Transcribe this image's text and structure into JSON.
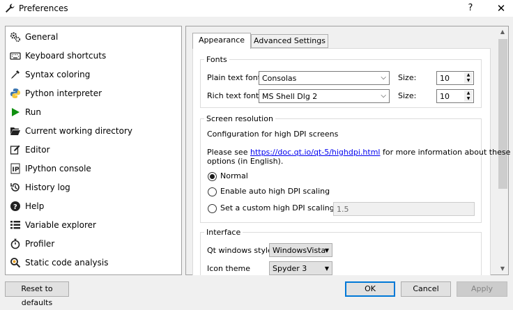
{
  "window": {
    "title": "Preferences",
    "help_glyph": "?",
    "close_glyph": "✕"
  },
  "sidebar": {
    "items": [
      {
        "label": "General",
        "icon": "gears-icon"
      },
      {
        "label": "Keyboard shortcuts",
        "icon": "keyboard-icon"
      },
      {
        "label": "Syntax coloring",
        "icon": "eyedropper-icon"
      },
      {
        "label": "Python interpreter",
        "icon": "python-icon"
      },
      {
        "label": "Run",
        "icon": "play-icon"
      },
      {
        "label": "Current working directory",
        "icon": "folder-open-icon"
      },
      {
        "label": "Editor",
        "icon": "edit-icon"
      },
      {
        "label": "IPython console",
        "icon": "ipython-icon"
      },
      {
        "label": "History log",
        "icon": "history-icon"
      },
      {
        "label": "Help",
        "icon": "question-circle-icon"
      },
      {
        "label": "Variable explorer",
        "icon": "table-list-icon"
      },
      {
        "label": "Profiler",
        "icon": "stopwatch-icon"
      },
      {
        "label": "Static code analysis",
        "icon": "code-analysis-icon"
      }
    ]
  },
  "tabs": [
    {
      "label": "Appearance",
      "selected": true
    },
    {
      "label": "Advanced Settings",
      "selected": false
    }
  ],
  "fonts": {
    "title": "Fonts",
    "plain_label": "Plain text font",
    "plain_value": "Consolas",
    "rich_label": "Rich text font",
    "rich_value": "MS Shell Dlg 2",
    "size_label": "Size:",
    "plain_size": "10",
    "rich_size": "10"
  },
  "screen": {
    "title": "Screen resolution",
    "config_text": "Configuration for high DPI screens",
    "info_prefix": "Please see ",
    "info_link": "https://doc.qt.io/qt-5/highdpi.html",
    "info_suffix": " for more information about these",
    "info_line2": "options (in English).",
    "radio_normal": "Normal",
    "radio_auto": "Enable auto high DPI scaling",
    "radio_custom": "Set a custom high DPI scaling",
    "selected": "Normal",
    "custom_value": "1.5"
  },
  "interface": {
    "title": "Interface",
    "style_label": "Qt windows style",
    "style_value": "WindowsVista",
    "theme_label": "Icon theme",
    "theme_value": "Spyder 3"
  },
  "buttons": {
    "reset": "Reset to defaults",
    "ok": "OK",
    "cancel": "Cancel",
    "apply": "Apply"
  },
  "colors": {
    "accent": "#0078d7",
    "link": "#0000ee",
    "run_green": "#109010"
  }
}
